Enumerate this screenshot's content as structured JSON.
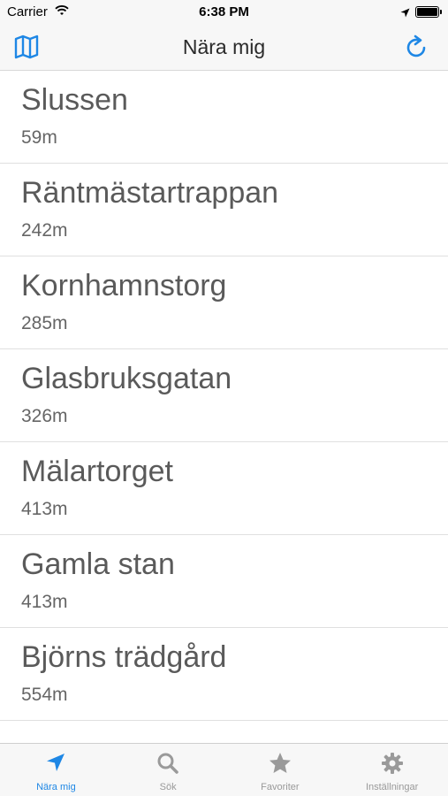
{
  "status_bar": {
    "carrier": "Carrier",
    "time": "6:38 PM"
  },
  "nav": {
    "title": "Nära mig",
    "left_icon": "map-icon",
    "right_icon": "refresh-icon"
  },
  "stops": [
    {
      "name": "Slussen",
      "distance": "59m"
    },
    {
      "name": "Räntmästartrappan",
      "distance": "242m"
    },
    {
      "name": "Kornhamnstorg",
      "distance": "285m"
    },
    {
      "name": "Glasbruksgatan",
      "distance": "326m"
    },
    {
      "name": "Mälartorget",
      "distance": "413m"
    },
    {
      "name": "Gamla stan",
      "distance": "413m"
    },
    {
      "name": "Björns trädgård",
      "distance": "554m"
    }
  ],
  "tabs": [
    {
      "label": "Nära mig",
      "icon": "location-arrow-icon",
      "active": true
    },
    {
      "label": "Sök",
      "icon": "search-icon",
      "active": false
    },
    {
      "label": "Favoriter",
      "icon": "star-icon",
      "active": false
    },
    {
      "label": "Inställningar",
      "icon": "gear-icon",
      "active": false
    }
  ],
  "colors": {
    "accent": "#1e87e5",
    "inactive": "#9a9a9a",
    "bar_bg": "#f7f7f7"
  }
}
